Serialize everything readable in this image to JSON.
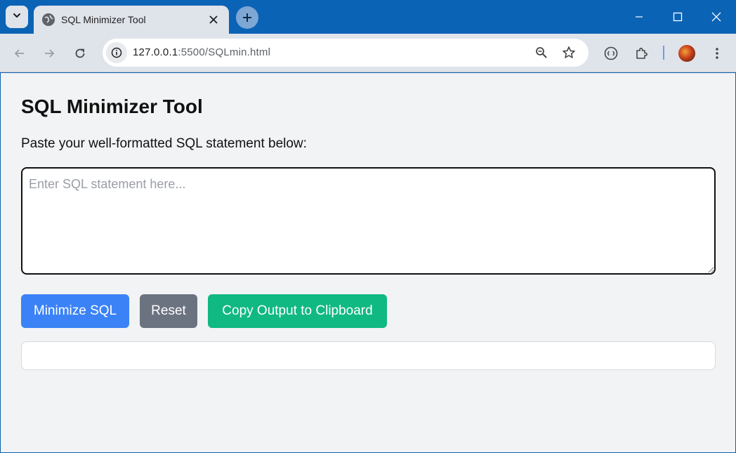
{
  "browser": {
    "tab_title": "SQL Minimizer Tool",
    "tab_close_glyph": "✕",
    "new_tab_glyph": "+",
    "url_host": "127.0.0.1",
    "url_rest": ":5500/SQLmin.html"
  },
  "icons": {
    "tab_search": "chevron-down-icon",
    "favicon": "globe-icon",
    "back": "arrow-left-icon",
    "forward": "arrow-right-icon",
    "reload": "reload-icon",
    "site_info": "info-icon",
    "zoom": "zoom-icon",
    "bookmark": "star-icon",
    "extensions": "puzzle-icon"
  },
  "page": {
    "title": "SQL Minimizer Tool",
    "prompt": "Paste your well-formatted SQL statement below:",
    "input_placeholder": "Enter SQL statement here...",
    "input_value": "",
    "buttons": {
      "minimize": "Minimize SQL",
      "reset": "Reset",
      "copy": "Copy Output to Clipboard"
    },
    "output_text": ""
  },
  "colors": {
    "minimize_button": "#3b82f6",
    "reset_button": "#6b7280",
    "copy_button": "#10b981",
    "titlebar": "#0b63b6"
  }
}
